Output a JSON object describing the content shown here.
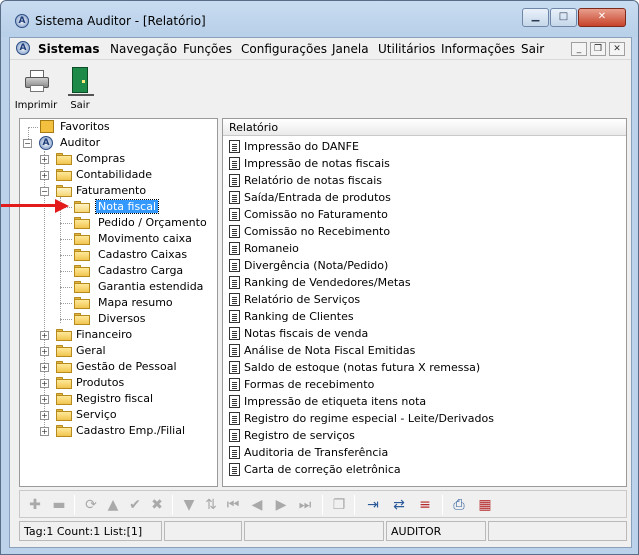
{
  "window": {
    "title": "Sistema Auditor - [Relatório]"
  },
  "menu": {
    "items": [
      "Sistemas",
      "Navegação",
      "Funções",
      "Configurações",
      "Janela",
      "Utilitários",
      "Informações",
      "Sair"
    ]
  },
  "toolbar": {
    "print_label": "Imprimir",
    "exit_label": "Sair"
  },
  "tree": {
    "favorites": "Favoritos",
    "root": "Auditor",
    "compras": "Compras",
    "contabilidade": "Contabilidade",
    "faturamento": "Faturamento",
    "faturamento_children": [
      "Nota fiscal",
      "Pedido / Orçamento",
      "Movimento caixa",
      "Cadastro Caixas",
      "Cadastro Carga",
      "Garantia estendida",
      "Mapa resumo",
      "Diversos"
    ],
    "selected": "Nota fiscal",
    "others": [
      "Financeiro",
      "Geral",
      "Gestão de Pessoal",
      "Produtos",
      "Registro fiscal",
      "Serviço",
      "Cadastro Emp./Filial"
    ]
  },
  "report_list": {
    "header": "Relatório",
    "items": [
      "Impressão do DANFE",
      "Impressão de notas fiscais",
      "Relatório de notas fiscais",
      "Saída/Entrada de produtos",
      "Comissão no Faturamento",
      "Comissão no Recebimento",
      "Romaneio",
      "Divergência (Nota/Pedido)",
      "Ranking de Vendedores/Metas",
      "Relatório de Serviços",
      "Ranking de Clientes",
      "Notas fiscais de venda",
      "Análise de Nota Fiscal Emitidas",
      "Saldo de estoque (notas futura X remessa)",
      "Formas de recebimento",
      "Impressão de etiqueta itens nota",
      "Registro do regime especial - Leite/Derivados",
      "Registro de serviços",
      "Auditoria de Transferência",
      "Carta de correção eletrônica"
    ]
  },
  "status": {
    "left": "Tag:1 Count:1 List:[1]",
    "user": "AUDITOR"
  },
  "colors": {
    "selection": "#3399ff",
    "arrow": "#e31b1b"
  }
}
